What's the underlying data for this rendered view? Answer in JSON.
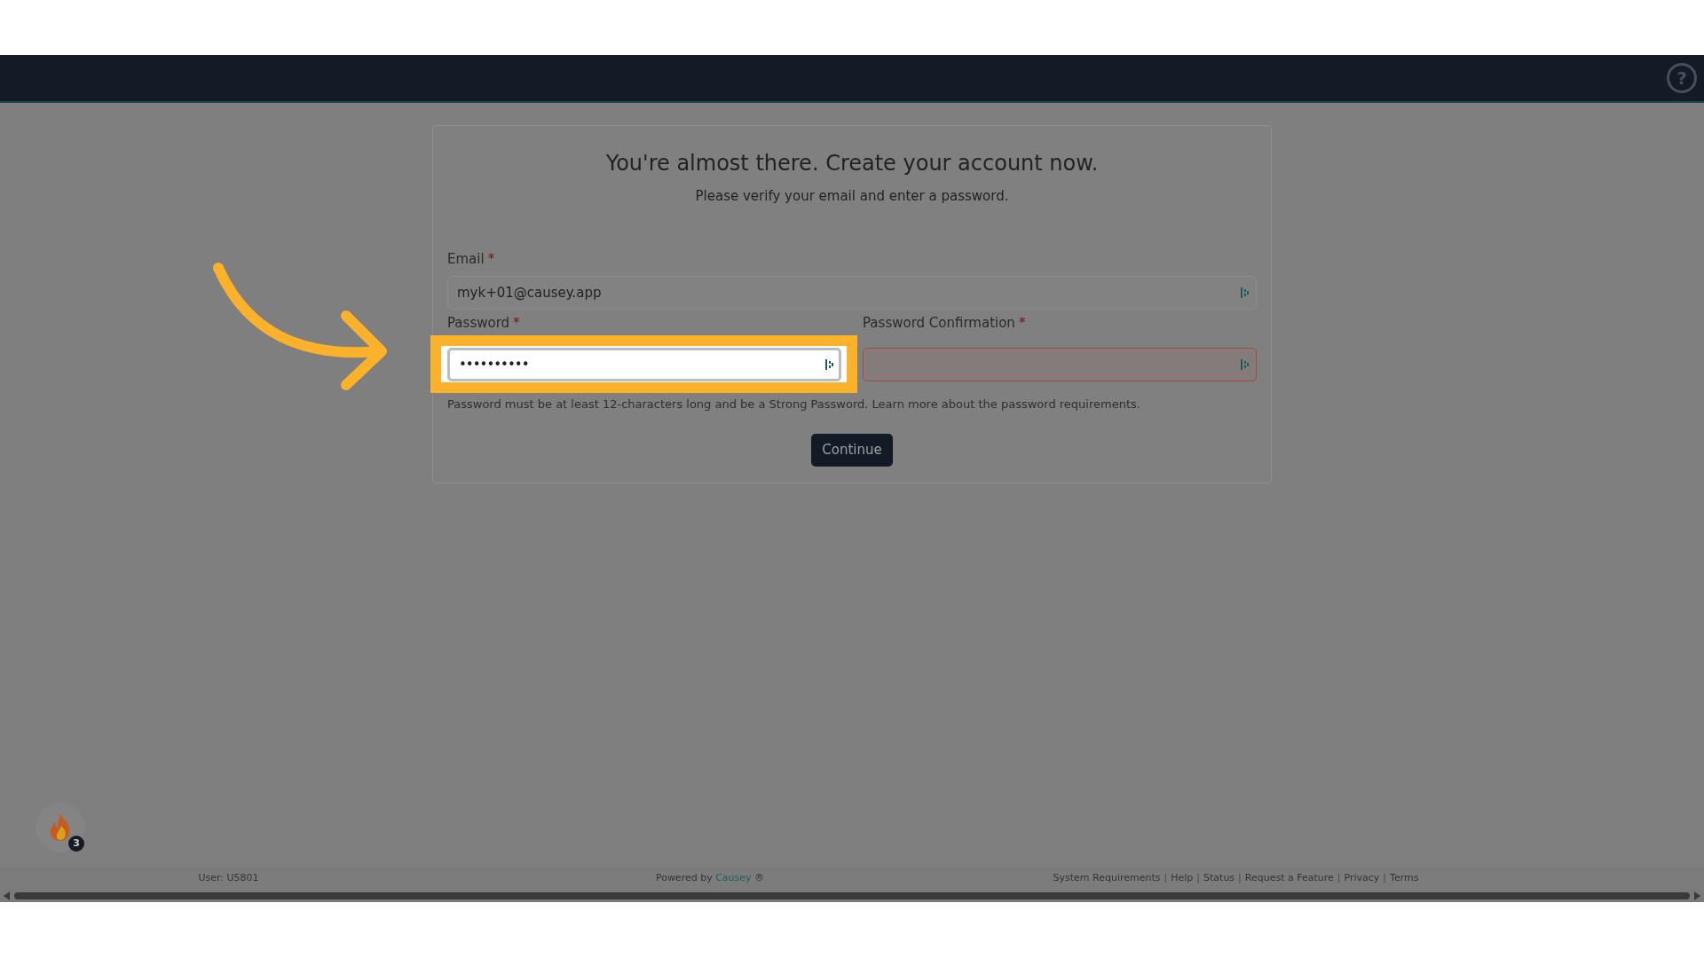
{
  "header": {
    "help_icon": "?"
  },
  "card": {
    "title": "You're almost there. Create your account now.",
    "subtitle": "Please verify your email and enter a password.",
    "fields": [
      {
        "kind": "email",
        "label": "Email",
        "required_mark": "*",
        "value": "myk+01@causey.app",
        "highlighted": false,
        "invalid": false
      },
      {
        "kind": "password",
        "label": "Password",
        "required_mark": "*",
        "value": "••••••••••",
        "highlighted": true,
        "invalid": false
      },
      {
        "kind": "password",
        "label": "Password Confirmation",
        "required_mark": "*",
        "highlighted": false,
        "invalid": true
      }
    ],
    "help_text": "Password must be at least 12-characters long and be a Strong Password. Learn more about the password requirements.",
    "button": "Continue"
  },
  "notification": {
    "badge": "3"
  },
  "footer": {
    "user": "User: U5801",
    "powered_by": "Powered by",
    "brand": "Causey",
    "brand_suffix": "®",
    "links": [
      {
        "kind": "link",
        "text": "System Requirements"
      },
      {
        "kind": "separator",
        "text": "|"
      },
      {
        "kind": "link",
        "text": "Help"
      },
      {
        "kind": "separator",
        "text": "|"
      },
      {
        "kind": "link",
        "text": "Status"
      },
      {
        "kind": "separator",
        "text": "|"
      },
      {
        "kind": "link",
        "text": "Request a Feature"
      },
      {
        "kind": "separator",
        "text": "|"
      },
      {
        "kind": "link",
        "text": "Privacy"
      },
      {
        "kind": "separator",
        "text": "|"
      },
      {
        "kind": "link",
        "text": "Terms"
      }
    ]
  }
}
